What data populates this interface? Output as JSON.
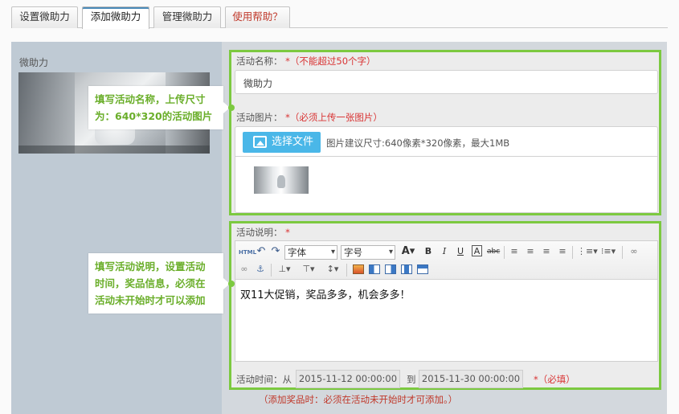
{
  "tabs": [
    {
      "label": "设置微助力"
    },
    {
      "label": "添加微助力"
    },
    {
      "label": "管理微助力"
    },
    {
      "label": "使用帮助？"
    }
  ],
  "left": {
    "title": "微助力"
  },
  "form": {
    "name_label": "活动名称：",
    "name_req": "*（不能超过50个字）",
    "name_value": "微助力",
    "image_label": "活动图片：",
    "image_req": "*（必须上传一张图片）",
    "upload_button": "选择文件",
    "upload_hint": "图片建议尺寸:640像素*320像素，最大1MB",
    "desc_label": "活动说明：",
    "desc_req": "*",
    "editor": {
      "font_select": "字体",
      "size_select": "字号",
      "content": "双11大促销，奖品多多，机会多多！"
    },
    "time_label": "活动时间：从",
    "start_time": "2015-11-12 00:00:00",
    "to_label": "到",
    "end_time": "2015-11-30 00:00:00",
    "time_req": "*（必填）"
  },
  "tips": {
    "tip1": [
      "填写活动名称，上传尺寸",
      "为：640*320的活动图片"
    ],
    "tip2": [
      "填写活动说明，设置活动",
      "时间，奖品信息，必须在",
      "活动未开始时才可以添加"
    ]
  },
  "bottom_note": "（添加奖品时：必须在活动未开始时才可添加。）",
  "colors": {
    "accent_green": "#7cc940",
    "upload_blue": "#4ab7e8",
    "required_red": "#d93333"
  }
}
